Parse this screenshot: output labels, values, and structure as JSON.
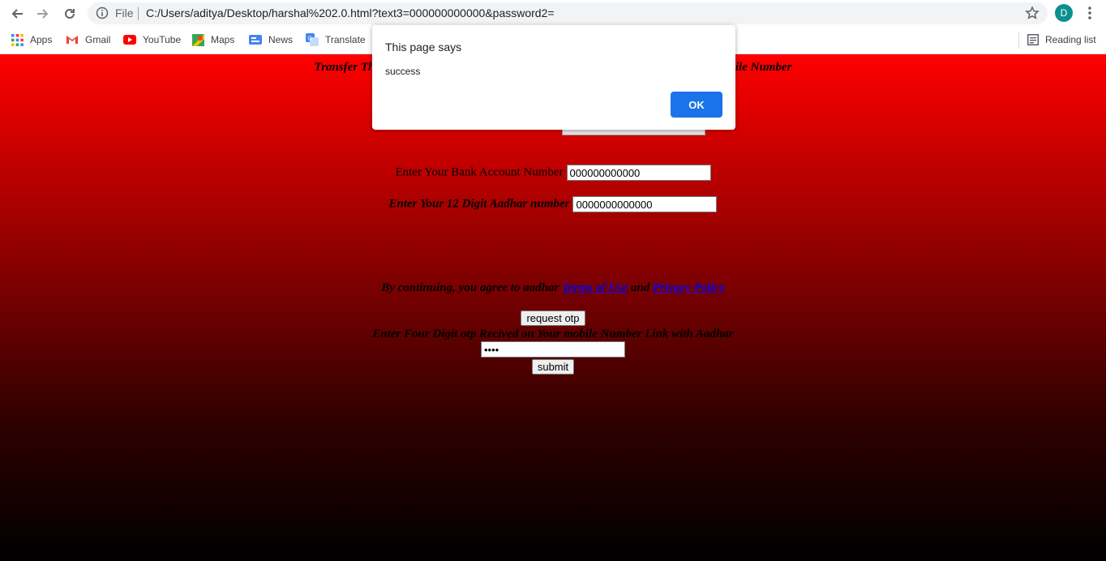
{
  "browser": {
    "file_label": "File",
    "url": "C:/Users/aditya/Desktop/harshal%202.0.html?text3=000000000000&password2=",
    "avatar_letter": "D",
    "bookmarks": [
      {
        "label": "Apps",
        "icon": "apps-grid-icon"
      },
      {
        "label": "Gmail",
        "icon": "gmail-icon"
      },
      {
        "label": "YouTube",
        "icon": "youtube-icon"
      },
      {
        "label": "Maps",
        "icon": "maps-icon"
      },
      {
        "label": "News",
        "icon": "news-icon"
      },
      {
        "label": "Translate",
        "icon": "translate-icon"
      }
    ],
    "reading_list_label": "Reading list"
  },
  "page": {
    "heading_left": "Transfer Th",
    "heading_right": "bile Number",
    "bank_label": "Enter Your Bank Account Number",
    "bank_value": "000000000000",
    "aadhar_label": "Enter Your 12 Digit Aadhar number",
    "aadhar_value": "0000000000000",
    "terms_prefix": "By continuing, you agree to aadhar ",
    "terms_link": "Terms of Use",
    "terms_and": " and ",
    "privacy_link": "Privacy Policy",
    "request_otp_label": "request otp",
    "otp_label": "Enter Four Digit otp Recived on Your mobile Number Link with Aadhar",
    "otp_value": "••••",
    "submit_label": "submit"
  },
  "dialog": {
    "title": "This page says",
    "message": "success",
    "ok_label": "OK"
  },
  "colors": {
    "gradient_top": "#ff0000",
    "gradient_bottom": "#000000",
    "ok_button": "#1a73e8",
    "link": "#0000ee"
  }
}
